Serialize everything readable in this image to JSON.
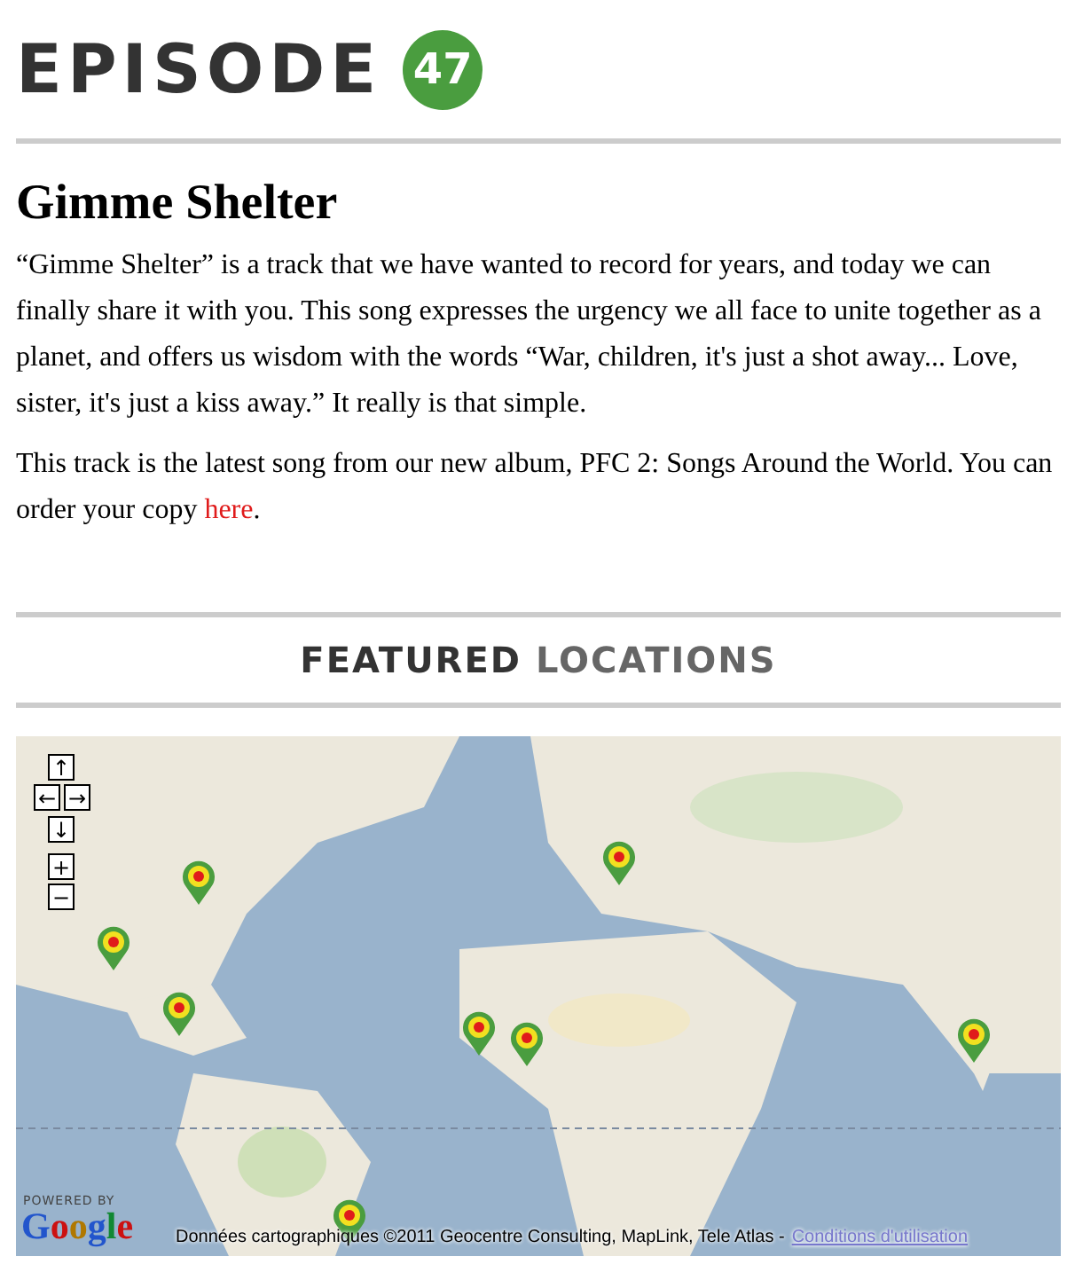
{
  "header": {
    "title": "EPISODE",
    "number": "47"
  },
  "article": {
    "title": "Gimme Shelter",
    "paragraphs": [
      {
        "text": "“Gimme Shelter” is a track that we have wanted to record for years, and today we can finally share it with you. This song expresses the urgency we all face to unite together as a planet, and offers us wisdom with the words “War, children, it's just a shot away... Love, sister, it's just a kiss away.”  It really is that simple."
      },
      {
        "text": "This track is the latest song from our new album, PFC 2: Songs Around the World.  You can order your copy ",
        "link": "here",
        "after": "."
      }
    ]
  },
  "section": {
    "title_bold": "FEATURED",
    "title_light": "LOCATIONS"
  },
  "map": {
    "controls": [
      {
        "kind": "up",
        "label": "↑"
      },
      {
        "kind": "left",
        "label": "←"
      },
      {
        "kind": "right",
        "label": "→"
      },
      {
        "kind": "down",
        "label": "↓"
      },
      {
        "kind": "zoom-in",
        "label": "+"
      },
      {
        "kind": "zoom-out",
        "label": "−"
      }
    ],
    "powered_by": "POWERED BY",
    "logo": "Google",
    "attribution": "Données cartographiques ©2011 Geocentre Consulting, MapLink, Tele Atlas -",
    "terms_link": "Conditions d'utilisation"
  }
}
